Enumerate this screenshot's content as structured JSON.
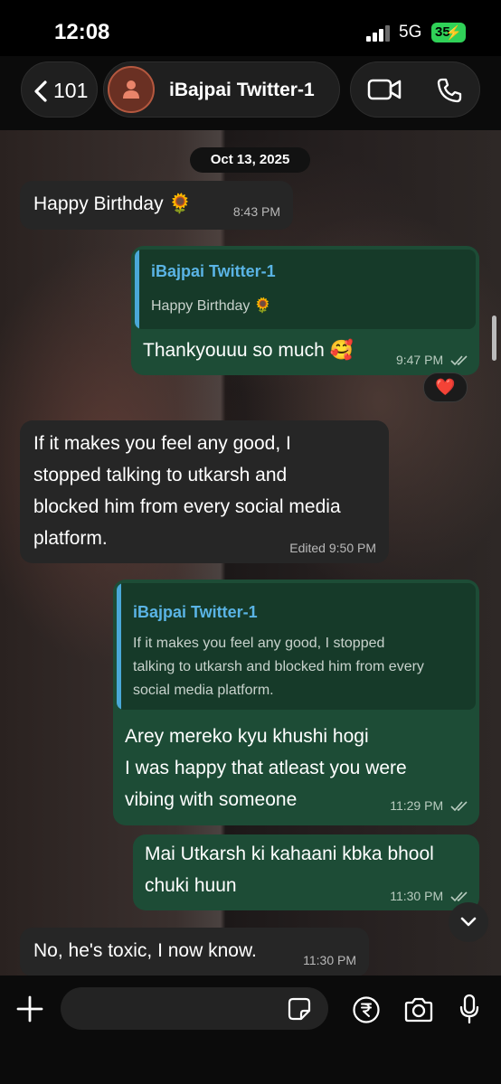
{
  "status_bar": {
    "time": "12:08",
    "network": "5G",
    "battery": "35",
    "battery_icon": "charging-bolt"
  },
  "header": {
    "back_count": "101",
    "contact_name": "iBajpai Twitter-1",
    "icons": [
      "chevron-left-icon",
      "person-icon",
      "video-call-icon",
      "phone-icon"
    ]
  },
  "chat": {
    "date_chip": "Oct 13, 2025",
    "messages": [
      {
        "direction": "incoming",
        "text": "Happy Birthday 🌻",
        "time": "8:43 PM"
      },
      {
        "direction": "outgoing",
        "quote_author": "iBajpai Twitter-1",
        "quote_text": "Happy Birthday 🌻",
        "text": "Thankyouuu so much 🥰",
        "time": "9:47 PM",
        "reaction": "❤️"
      },
      {
        "direction": "incoming",
        "lines": [
          "If it makes you feel any good, I",
          "stopped talking to utkarsh and",
          "blocked him from every social media",
          "platform."
        ],
        "time": "Edited 9:50 PM"
      },
      {
        "direction": "outgoing",
        "quote_author": "iBajpai Twitter-1",
        "quote_lines": [
          "If it makes you feel any good, I stopped",
          "talking to utkarsh and blocked him from every",
          "social media platform."
        ],
        "lines": [
          "Arey mereko kyu khushi hogi",
          "I was happy that atleast you were",
          "vibing with someone"
        ],
        "time": "11:29 PM"
      },
      {
        "direction": "outgoing",
        "lines": [
          "Mai Utkarsh ki kahaani kbka bhool",
          "chuki huun"
        ],
        "time": "11:30 PM"
      },
      {
        "direction": "incoming",
        "text": "No, he's toxic, I now know.",
        "time": "11:30 PM"
      }
    ]
  },
  "composer": {
    "placeholder": "",
    "icons": [
      "plus-icon",
      "sticker-icon",
      "rupee-payment-icon",
      "camera-icon",
      "microphone-icon"
    ]
  },
  "colors": {
    "outgoing_bubble": "#1d4c36",
    "incoming_bubble": "#262626",
    "quote_accent": "#4aa8d8",
    "battery": "#30d158",
    "reaction_heart": "#e8263d"
  }
}
